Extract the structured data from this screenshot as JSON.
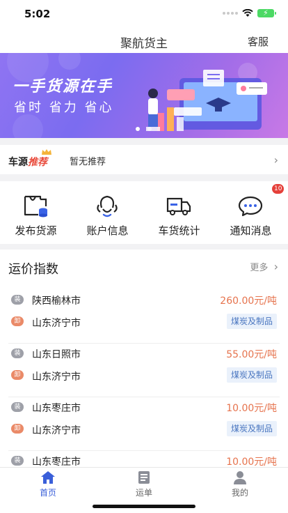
{
  "status": {
    "time": "5:02"
  },
  "nav": {
    "title": "聚航货主",
    "service": "客服"
  },
  "banner": {
    "line1": "一手货源在手",
    "line2": "省时 省力 省心"
  },
  "recommend": {
    "brand_a": "车源",
    "brand_b": "推荐",
    "text": "暂无推荐"
  },
  "quick": [
    {
      "label": "发布货源",
      "icon": "publish-bag-icon"
    },
    {
      "label": "账户信息",
      "icon": "account-face-icon"
    },
    {
      "label": "车货统计",
      "icon": "truck-icon"
    },
    {
      "label": "通知消息",
      "icon": "message-bubble-icon",
      "badge": "10"
    }
  ],
  "price_index": {
    "title": "运价指数",
    "more": "更多",
    "load_tag": "装",
    "unload_tag": "卸",
    "routes": [
      {
        "from": "陕西榆林市",
        "to": "山东济宁市",
        "price": "260.00元/吨",
        "cargo": "煤炭及制品"
      },
      {
        "from": "山东日照市",
        "to": "山东济宁市",
        "price": "55.00元/吨",
        "cargo": "煤炭及制品"
      },
      {
        "from": "山东枣庄市",
        "to": "山东济宁市",
        "price": "10.00元/吨",
        "cargo": "煤炭及制品"
      },
      {
        "from": "山东枣庄市",
        "to": "",
        "price": "10.00元/吨",
        "cargo": ""
      }
    ]
  },
  "tabs": [
    {
      "label": "首页",
      "active": true
    },
    {
      "label": "运单",
      "active": false
    },
    {
      "label": "我的",
      "active": false
    }
  ],
  "colors": {
    "accent": "#3a5fd9",
    "price": "#e6734d",
    "badge": "#e5403a"
  }
}
